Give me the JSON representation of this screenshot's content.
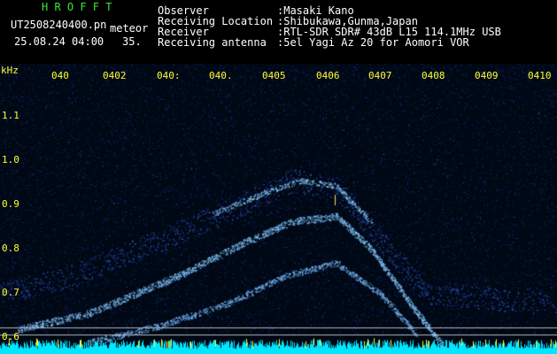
{
  "header": {
    "program": "H R O F F T",
    "filename": "UT2508240400.pn",
    "tag": "meteor",
    "datetime": "25.08.24 04:00",
    "seconds": "35.",
    "info_labels": [
      "Observer",
      "Receiving Location",
      "Receiver",
      "Receiving antenna"
    ],
    "info_values": [
      ":Masaki Kano",
      ":Shibukawa,Gunma,Japan",
      ":RTL-SDR SDR# 43dB L15 114.1MHz USB",
      ":5el Yagi Az 20 for Aomori VOR"
    ]
  },
  "spectrogram": {
    "unit": "kHz",
    "y_ticks": [
      "1.1",
      "1.0",
      "0.9",
      "0.8",
      "0.7",
      "0.6"
    ],
    "x_ticks": [
      "040",
      "0402",
      "040:",
      "040.",
      "0405",
      "0406",
      "0407",
      "0408",
      "0409",
      "0410"
    ],
    "colors": {
      "background": "#000814",
      "noise": "#1a3aa8",
      "signal": "#7fc8ff",
      "floor": "#00e6ff",
      "label": "#ffff33"
    }
  }
}
